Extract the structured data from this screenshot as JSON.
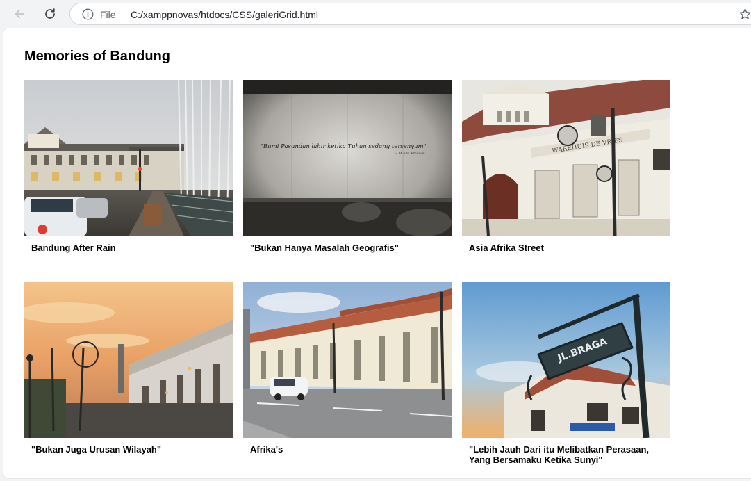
{
  "browser": {
    "site_label": "File",
    "url": "C:/xamppnovas/htdocs/CSS/galeriGrid.html"
  },
  "page": {
    "title": "Memories of Bandung"
  },
  "gallery": [
    {
      "caption": "Bandung After Rain",
      "photo": "rainy-street-photo"
    },
    {
      "caption": "\"Bukan Hanya Masalah Geografis\"",
      "photo": "quote-wall-photo",
      "quote": "\"Bumi Pasundan lahir ketika Tuhan sedang tersenyum\"",
      "quote_author": "— M.A.W. Brouwer"
    },
    {
      "caption": "Asia Afrika Street",
      "photo": "colonial-building-photo",
      "sign": "WAREHUIS DE VRIES"
    },
    {
      "caption": "\"Bukan Juga Urusan Wilayah\"",
      "photo": "sunset-street-photo"
    },
    {
      "caption": "Afrika's",
      "photo": "asia-afrika-avenue-photo"
    },
    {
      "caption": "\"Lebih Jauh Dari itu Melibatkan Perasaan, Yang Bersamaku Ketika Sunyi\"",
      "photo": "braga-sign-photo",
      "sign": "JL.BRAGA"
    }
  ],
  "icons": {
    "back": "arrow-left-icon",
    "reload": "reload-icon",
    "info": "info-icon",
    "bookmark": "star-icon"
  }
}
